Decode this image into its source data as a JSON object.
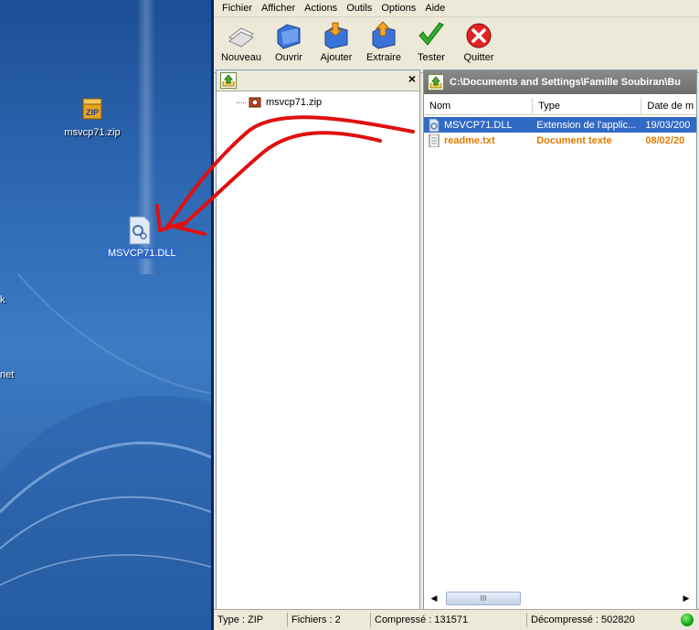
{
  "desktop": {
    "icons": [
      {
        "label": "msvcp71.zip",
        "icon": "zip-archive-icon"
      },
      {
        "label": "MSVCP71.DLL",
        "icon": "dll-file-icon",
        "selected": true
      }
    ],
    "partial_labels": [
      "k",
      "net"
    ]
  },
  "window": {
    "menu": [
      "Fichier",
      "Afficher",
      "Actions",
      "Outils",
      "Options",
      "Aide"
    ],
    "toolbar": {
      "new": "Nouveau",
      "open": "Ouvrir",
      "add": "Ajouter",
      "extract": "Extraire",
      "test": "Tester",
      "quit": "Quitter"
    },
    "left_pane": {
      "close_glyph": "×",
      "tree_item": "msvcp71.zip"
    },
    "right_pane": {
      "path": "C:\\Documents and Settings\\Famille Soubiran\\Bu",
      "columns": [
        "Nom",
        "Type",
        "Date de m"
      ],
      "rows": [
        {
          "name": "MSVCP71.DLL",
          "type": "Extension de l'applic...",
          "date": "19/03/200",
          "selected": true,
          "icon": "dll-file-icon"
        },
        {
          "name": "readme.txt",
          "type": "Document texte",
          "date": "08/02/20",
          "selected": false,
          "icon": "text-file-icon"
        }
      ],
      "scroll_thumb_glyph": "III"
    },
    "status": {
      "type": "Type : ZIP",
      "files": "Fichiers : 2",
      "compressed": "Compressé : 131571",
      "decompressed": "Décompressé : 502820"
    }
  },
  "colors": {
    "selection": "#316ac5",
    "text_file_row": "#e07b00",
    "arrow": "#e01010"
  }
}
